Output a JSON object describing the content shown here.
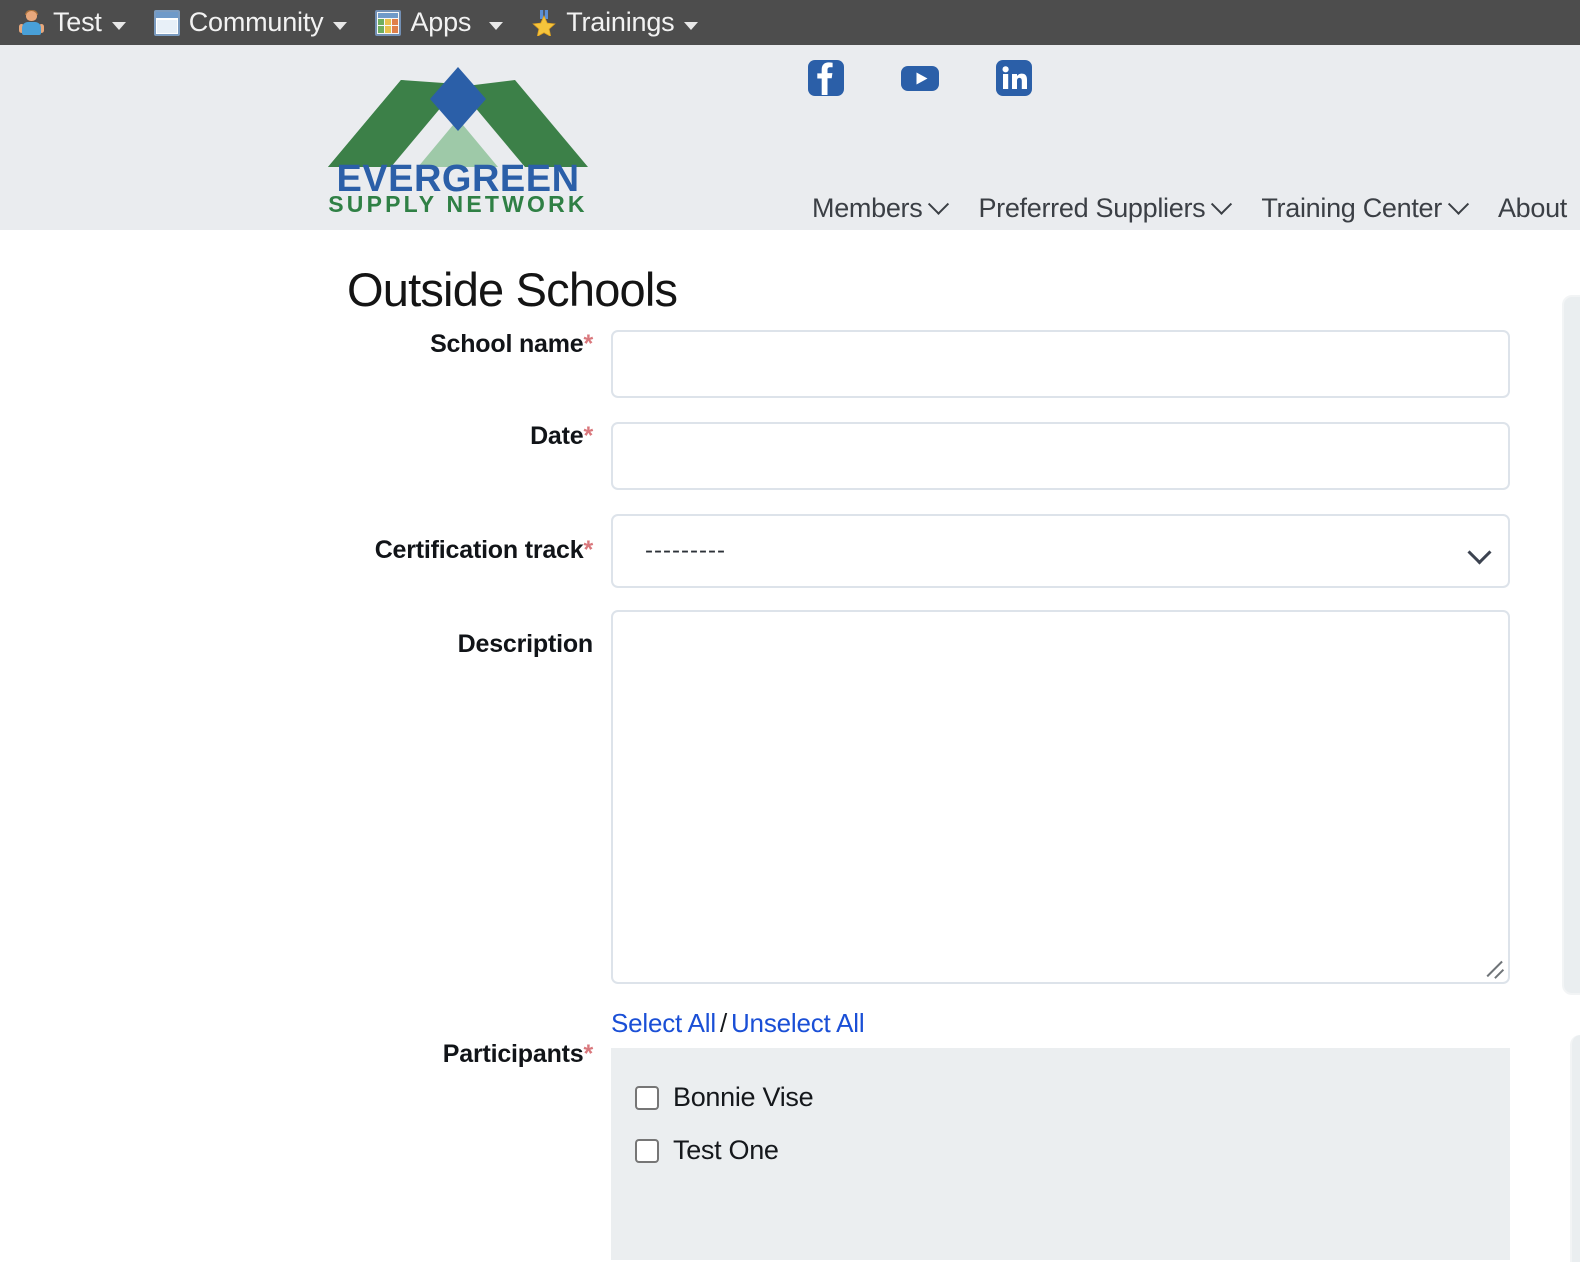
{
  "toolbar": {
    "items": [
      {
        "label": "Test",
        "icon": "person-icon",
        "has_caret": true
      },
      {
        "label": "Community",
        "icon": "window-icon",
        "has_caret": true
      },
      {
        "label": "Apps",
        "icon": "apps-grid-icon",
        "has_caret": true
      },
      {
        "label": "Trainings",
        "icon": "star-icon",
        "has_caret": true
      }
    ]
  },
  "header": {
    "logo": {
      "title": "EVERGREEN",
      "subtitle": "SUPPLY NETWORK",
      "colors": {
        "blue": "#2b5fa8",
        "green_dark": "#3c8048",
        "green_light": "#9ec9a8",
        "wordmark_blue": "#2b5fa8",
        "wordmark_green": "#2f8045"
      }
    },
    "social": [
      {
        "name": "facebook-icon",
        "label": "Facebook"
      },
      {
        "name": "youtube-icon",
        "label": "YouTube"
      },
      {
        "name": "linkedin-icon",
        "label": "LinkedIn"
      }
    ],
    "nav": [
      {
        "label": "Members",
        "has_chevron": true
      },
      {
        "label": "Preferred Suppliers",
        "has_chevron": true
      },
      {
        "label": "Training Center",
        "has_chevron": true
      },
      {
        "label": "About",
        "has_chevron": false
      }
    ]
  },
  "main": {
    "title": "Outside Schools",
    "fields": {
      "school_name": {
        "label": "School name",
        "required_mark": "*",
        "value": "",
        "placeholder": ""
      },
      "date": {
        "label": "Date",
        "required_mark": "*",
        "value": "",
        "placeholder": ""
      },
      "certification_track": {
        "label": "Certification track",
        "required_mark": "*",
        "value": "---------",
        "chevron": "chevron-down-icon"
      },
      "description": {
        "label": "Description",
        "required_mark": "",
        "value": "",
        "placeholder": ""
      },
      "participants": {
        "label": "Participants",
        "required_mark": "*",
        "select_all": "Select All",
        "separator": "/",
        "unselect_all": "Unselect All",
        "options": [
          {
            "label": "Bonnie Vise",
            "checked": false
          },
          {
            "label": "Test One",
            "checked": false
          }
        ]
      }
    }
  },
  "colors": {
    "toolbar_bg": "#4d4d4d",
    "header_bg": "#eaecef",
    "accent_link": "#1a4fd6",
    "required_red": "#d9777c",
    "field_border": "#dde3ea",
    "checkbox_panel": "#ebeef0"
  }
}
